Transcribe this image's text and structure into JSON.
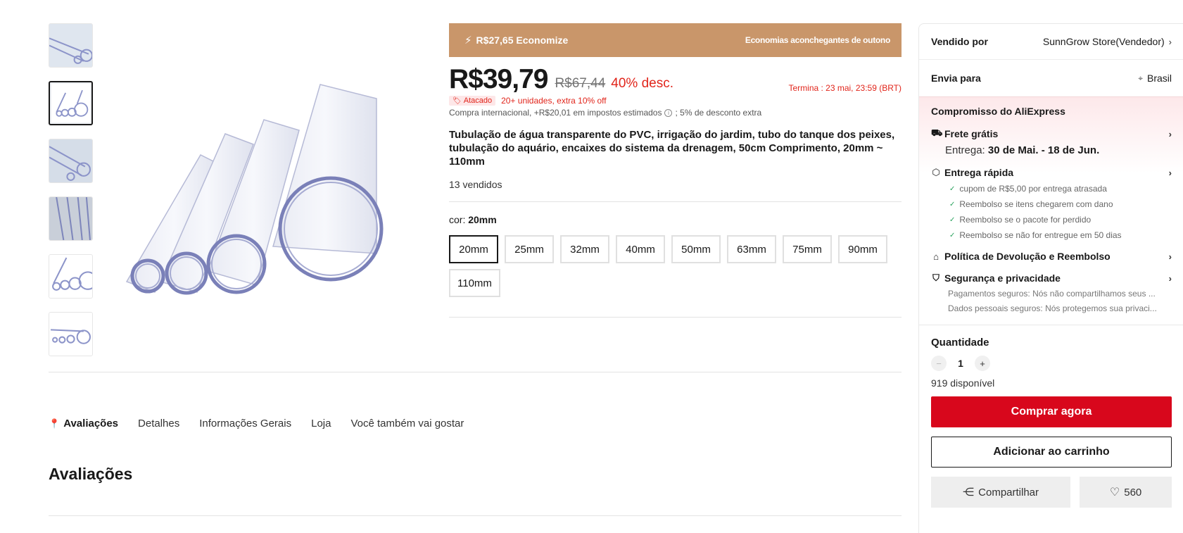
{
  "promo": {
    "bolt_icon": "lightning-icon",
    "savings": "R$27,65 Economize",
    "campaign": "Economias aconchegantes de outono"
  },
  "price": {
    "current": "R$39,79",
    "original": "R$67,44",
    "discount": "40% desc.",
    "countdown": "Termina :  23 mai, 23:59 (BRT)"
  },
  "bulk": {
    "badge": "Atacado",
    "text": "20+ unidades, extra 10% off"
  },
  "tax": {
    "text": "Compra internacional, +R$20,01 em impostos estimados",
    "extra": "; 5% de desconto extra"
  },
  "product": {
    "title": "Tubulação de água transparente do PVC, irrigação do jardim, tubo do tanque dos peixes, tubulação do aquário, encaixes do sistema da drenagem, 50cm Comprimento, 20mm ~ 110mm",
    "sold": "13 vendidos"
  },
  "variant": {
    "label": "cor: ",
    "selected": "20mm",
    "options": [
      "20mm",
      "25mm",
      "32mm",
      "40mm",
      "50mm",
      "63mm",
      "75mm",
      "90mm",
      "110mm"
    ]
  },
  "tabs": [
    "Avaliações",
    "Detalhes",
    "Informações Gerais",
    "Loja",
    "Você também vai gostar"
  ],
  "section_title": "Avaliações",
  "panel": {
    "seller_label": "Vendido por",
    "seller_name": "SunnGrow Store(Vendedor)",
    "ship_label": "Envia para",
    "ship_country": "Brasil",
    "commitment_title": "Compromisso do AliExpress",
    "free_shipping": "Frete grátis",
    "delivery_label": "Entrega: ",
    "delivery_dates": "30 de Mai. - 18 de Jun.",
    "fast_delivery": "Entrega rápida",
    "fast_items": [
      "cupom de R$5,00 por entrega atrasada",
      "Reembolso se itens chegarem com dano",
      "Reembolso se o pacote for perdido",
      "Reembolso se não for entregue em 50 dias"
    ],
    "return_policy": "Política de Devolução e Reembolso",
    "security": "Segurança e privacidade",
    "security_items": [
      "Pagamentos seguros: Nós não compartilhamos seus ...",
      "Dados pessoais seguros: Nós protegemos sua privaci..."
    ],
    "quantity_label": "Quantidade",
    "quantity": "1",
    "available": "919 disponível",
    "buy_now": "Comprar agora",
    "add_to_cart": "Adicionar ao carrinho",
    "share": "Compartilhar",
    "wishlist_count": "560"
  },
  "colors": {
    "promo_bg": "#c9966a",
    "accent_red": "#d8071c",
    "discount_red": "#e1251b"
  }
}
